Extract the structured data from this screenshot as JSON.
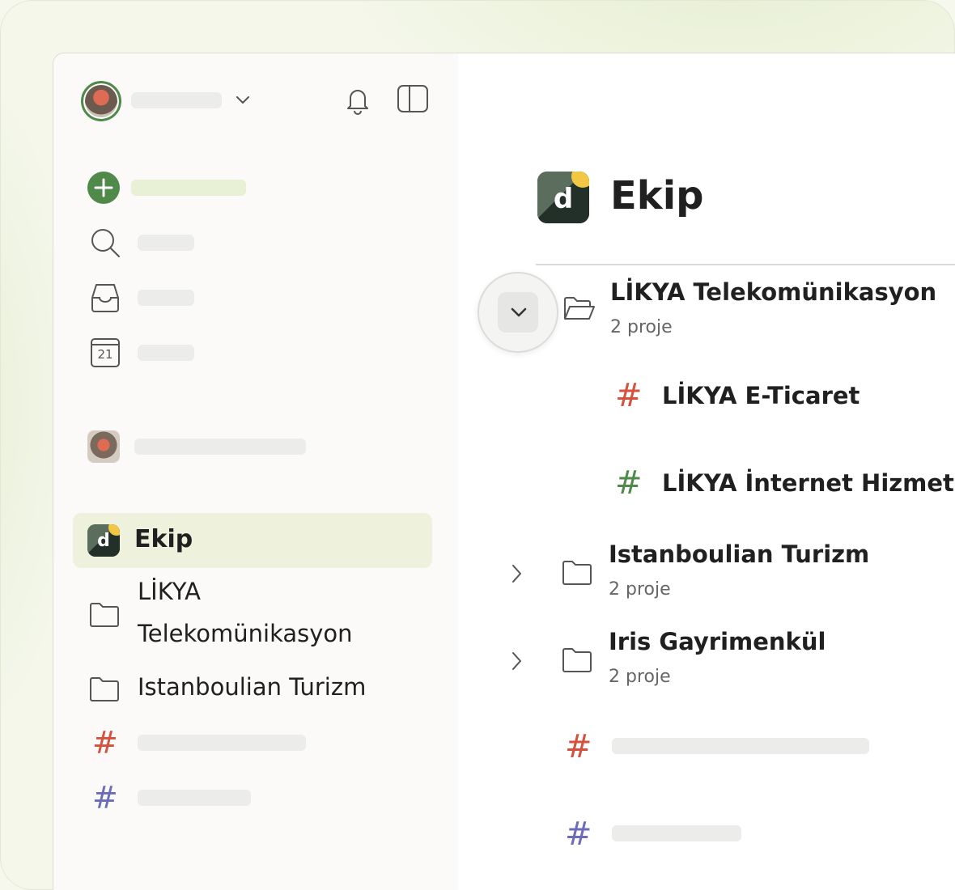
{
  "colors": {
    "accent_green": "#4f8a4a",
    "hash_red": "#d6503e",
    "hash_green": "#4f8a4a",
    "hash_purple": "#6c6cb8",
    "active_bg": "#eef2dc"
  },
  "sidebar": {
    "icons": {
      "add": "plus-circle-icon",
      "search": "search-icon",
      "inbox": "inbox-icon",
      "today": "calendar-icon",
      "notifications": "bell-icon",
      "toggle": "sidebar-toggle-icon"
    },
    "calendar_day": "21",
    "team": {
      "name": "Ekip",
      "logo_letter": "d"
    },
    "folders": [
      {
        "line1": "LİKYA",
        "line2": "Telekomünikasyon"
      },
      {
        "label": "Istanboulian Turizm"
      }
    ]
  },
  "main": {
    "title": "Ekip",
    "logo_letter": "d",
    "folders": [
      {
        "name": "LİKYA Telekomünikasyon",
        "count": "2 proje",
        "expanded": true,
        "projects": [
          {
            "name": "LİKYA E-Ticaret",
            "hash_color": "red"
          },
          {
            "name": "LİKYA İnternet Hizmetleri",
            "hash_color": "green"
          }
        ]
      },
      {
        "name": "Istanboulian Turizm",
        "count": "2 proje",
        "expanded": false
      },
      {
        "name": "Iris Gayrimenkül",
        "count": "2 proje",
        "expanded": false
      }
    ],
    "hash_symbol": "#"
  }
}
